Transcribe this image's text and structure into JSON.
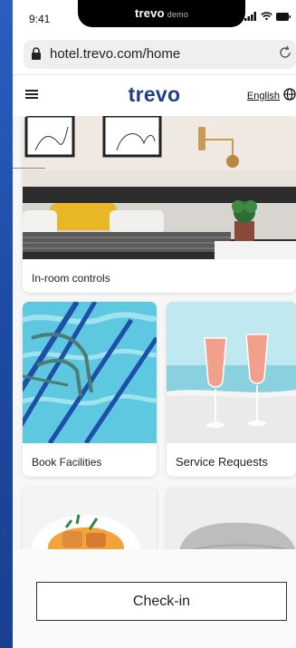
{
  "status": {
    "time": "9:41",
    "notch_brand": "trevo",
    "notch_demo": "demo"
  },
  "browser": {
    "url": "hotel.trevo.com/home"
  },
  "header": {
    "logo": "trevo",
    "language": "English"
  },
  "cards": [
    {
      "label": "In-room controls"
    },
    {
      "label": "Book Facilities"
    },
    {
      "label": "Service Requests"
    }
  ],
  "bottom": {
    "checkin_label": "Check-in"
  },
  "colors": {
    "brand": "#1e3f86",
    "background": "#1f4fa8"
  }
}
